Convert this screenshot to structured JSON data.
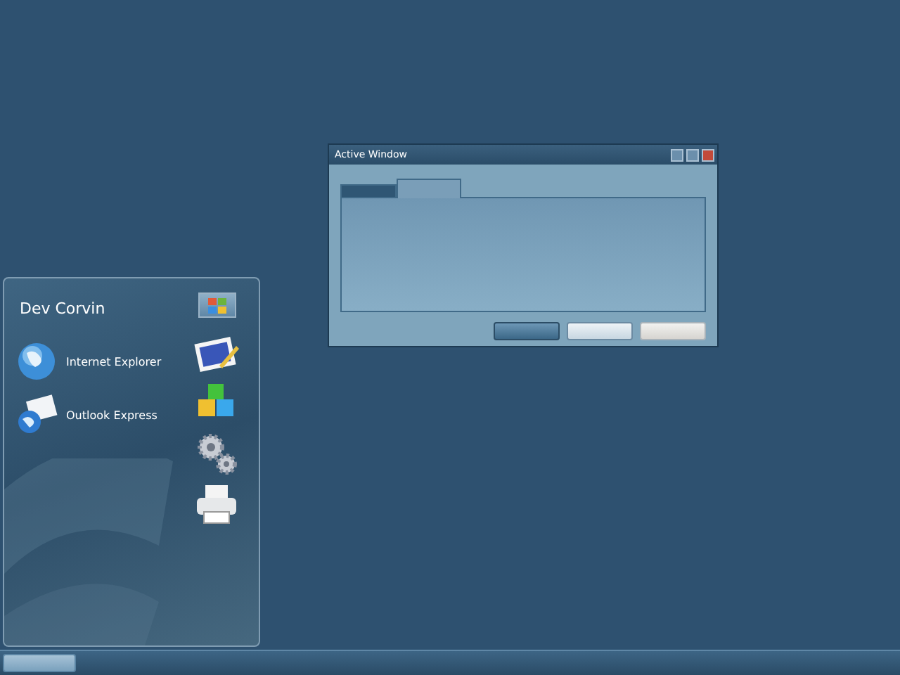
{
  "window": {
    "title": "Active Window",
    "tabs": [
      {
        "selected": false
      },
      {
        "selected": true
      }
    ],
    "buttons": [
      {
        "default": true,
        "disabled": false
      },
      {
        "default": false,
        "disabled": false
      },
      {
        "default": false,
        "disabled": true
      }
    ]
  },
  "start_menu": {
    "user": "Dev Corvin",
    "programs": [
      {
        "label": "Internet Explorer",
        "kind": "globe"
      },
      {
        "label": "Outlook Express",
        "kind": "mail"
      }
    ],
    "side_icons": [
      {
        "kind": "picture"
      },
      {
        "kind": "cubes"
      },
      {
        "kind": "gears"
      },
      {
        "kind": "printer"
      }
    ]
  },
  "taskbar": {
    "start_button": {
      "pressed": false
    }
  }
}
